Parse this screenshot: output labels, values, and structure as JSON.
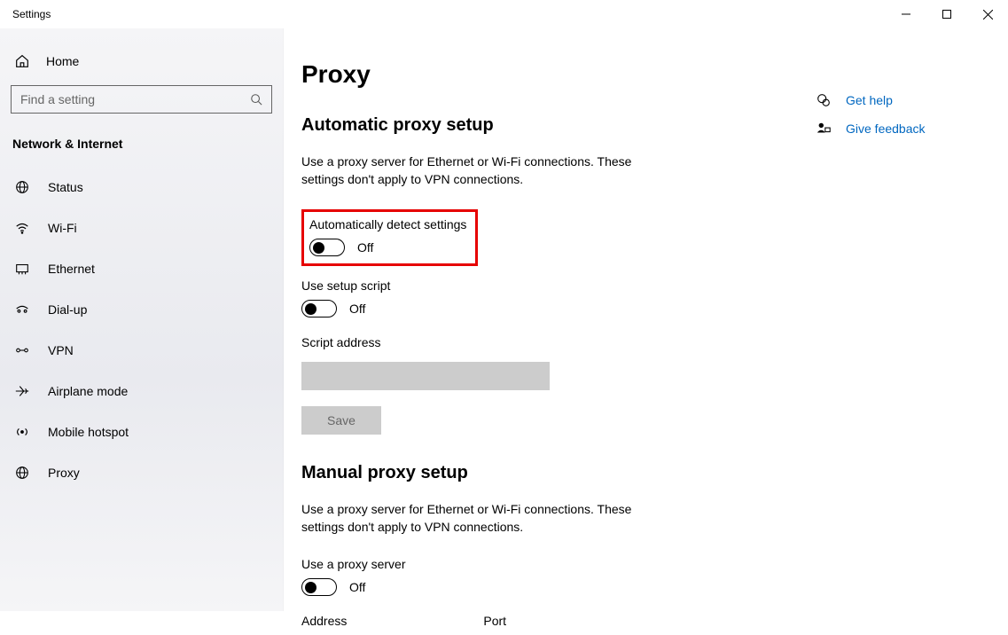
{
  "window": {
    "title": "Settings"
  },
  "sidebar": {
    "home": "Home",
    "search_placeholder": "Find a setting",
    "category": "Network & Internet",
    "items": [
      {
        "label": "Status"
      },
      {
        "label": "Wi-Fi"
      },
      {
        "label": "Ethernet"
      },
      {
        "label": "Dial-up"
      },
      {
        "label": "VPN"
      },
      {
        "label": "Airplane mode"
      },
      {
        "label": "Mobile hotspot"
      },
      {
        "label": "Proxy"
      }
    ]
  },
  "page": {
    "title": "Proxy",
    "auto": {
      "heading": "Automatic proxy setup",
      "desc": "Use a proxy server for Ethernet or Wi-Fi connections. These settings don't apply to VPN connections.",
      "detect_label": "Automatically detect settings",
      "detect_state": "Off",
      "script_label": "Use setup script",
      "script_state": "Off",
      "address_label": "Script address",
      "save_label": "Save"
    },
    "manual": {
      "heading": "Manual proxy setup",
      "desc": "Use a proxy server for Ethernet or Wi-Fi connections. These settings don't apply to VPN connections.",
      "use_label": "Use a proxy server",
      "use_state": "Off",
      "address_label": "Address",
      "port_label": "Port"
    }
  },
  "side": {
    "help": "Get help",
    "feedback": "Give feedback"
  }
}
